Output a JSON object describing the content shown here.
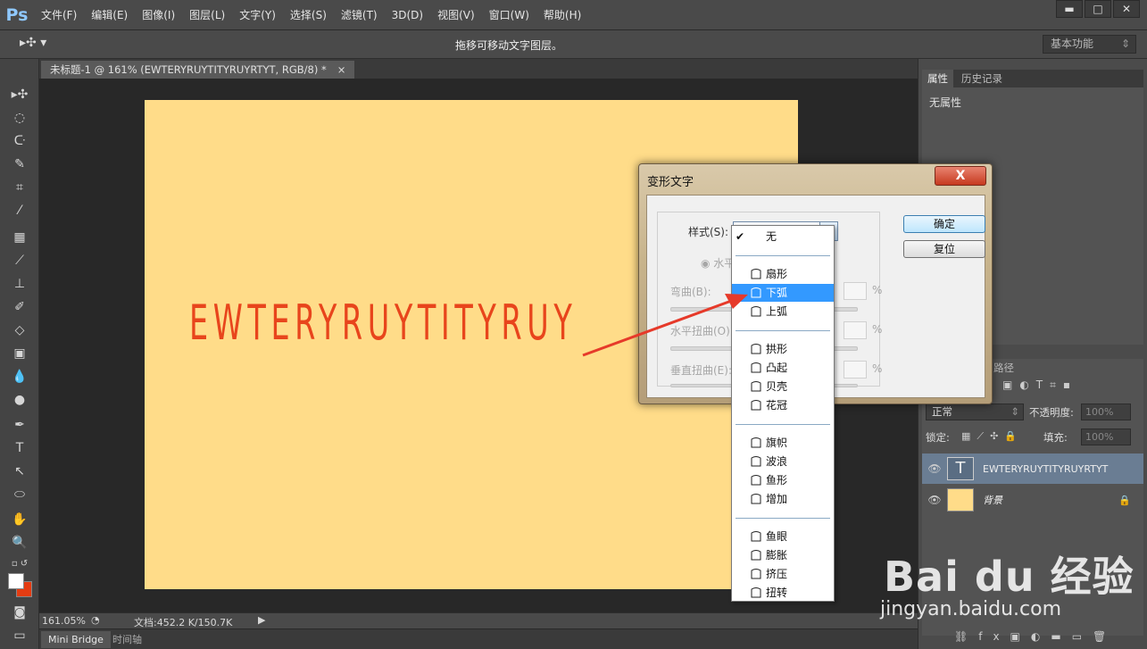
{
  "app": {
    "logo": "Ps"
  },
  "menu": [
    "文件(F)",
    "编辑(E)",
    "图像(I)",
    "图层(L)",
    "文字(Y)",
    "选择(S)",
    "滤镜(T)",
    "3D(D)",
    "视图(V)",
    "窗口(W)",
    "帮助(H)"
  ],
  "window_controls": {
    "minimize": "▬",
    "maximize": "□",
    "close": "✕"
  },
  "options_bar": {
    "tool_icon": "move-tool-icon",
    "hint": "拖移可移动文字图层。",
    "workspace": "基本功能"
  },
  "document": {
    "tab_title": "未标题-1 @ 161% (EWTERYRUYTITYRUYRTYT, RGB/8) *",
    "tab_close": "×",
    "canvas_text": "EWTERYRUYTITYRUY",
    "canvas_color": "#ffdc89",
    "text_color": "#e8451c"
  },
  "status": {
    "zoom": "161.05%",
    "doc_info": "文档:452.2 K/150.7K"
  },
  "bottom_tabs": [
    "Mini Bridge",
    "时间轴"
  ],
  "properties_panel": {
    "tabs": [
      "属性",
      "历史记录"
    ],
    "empty_text": "无属性"
  },
  "layers_panel": {
    "paths_tab": "路径",
    "blend_mode": "正常",
    "opacity_label": "不透明度:",
    "opacity_value": "100%",
    "lock_label": "锁定:",
    "fill_label": "填充:",
    "fill_value": "100%",
    "layers": [
      {
        "name": "EWTERYRUYTITYRUYRTYT",
        "type": "text",
        "thumb_glyph": "T"
      },
      {
        "name": "背景",
        "type": "background",
        "thumb_color": "#ffdc89"
      }
    ]
  },
  "dialog": {
    "title": "变形文字",
    "close": "X",
    "style_label": "样式(S):",
    "style_value": "无",
    "horizontal_radio": "水平",
    "bend_label": "弯曲(B):",
    "h_distort_label": "水平扭曲(O):",
    "v_distort_label": "垂直扭曲(E):",
    "percent": "%",
    "ok": "确定",
    "reset": "复位"
  },
  "dropdown": {
    "items": [
      {
        "label": "无",
        "checked": true,
        "group": 0
      },
      {
        "label": "扇形",
        "group": 1
      },
      {
        "label": "下弧",
        "group": 1,
        "selected": true
      },
      {
        "label": "上弧",
        "group": 1
      },
      {
        "label": "拱形",
        "group": 2
      },
      {
        "label": "凸起",
        "group": 2
      },
      {
        "label": "贝壳",
        "group": 2
      },
      {
        "label": "花冠",
        "group": 2
      },
      {
        "label": "旗帜",
        "group": 3
      },
      {
        "label": "波浪",
        "group": 3
      },
      {
        "label": "鱼形",
        "group": 3
      },
      {
        "label": "增加",
        "group": 3
      },
      {
        "label": "鱼眼",
        "group": 4
      },
      {
        "label": "膨胀",
        "group": 4
      },
      {
        "label": "挤压",
        "group": 4
      },
      {
        "label": "扭转",
        "group": 4
      }
    ]
  },
  "watermark": {
    "logo": "Bai du 经验",
    "url": "jingyan.baidu.com"
  }
}
